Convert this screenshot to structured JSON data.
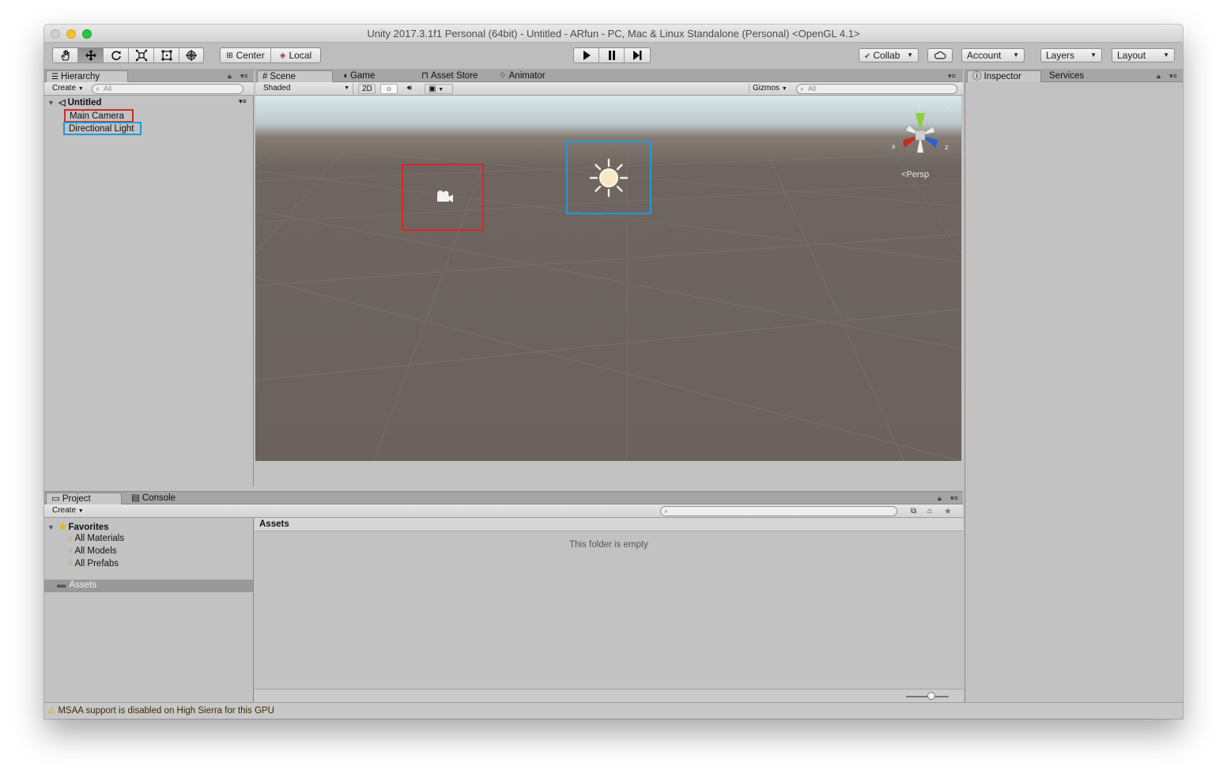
{
  "window": {
    "title": "Unity 2017.3.1f1 Personal (64bit) - Untitled - ARfun - PC, Mac & Linux Standalone (Personal) <OpenGL 4.1>"
  },
  "toolbar": {
    "transform_tools": [
      "hand-tool",
      "move-tool",
      "rotate-tool",
      "scale-tool",
      "rect-tool",
      "transform-tool"
    ],
    "pivot_label": "Center",
    "space_label": "Local",
    "collab_label": "Collab",
    "account_label": "Account",
    "layers_label": "Layers",
    "layout_label": "Layout"
  },
  "hierarchy": {
    "tab_label": "Hierarchy",
    "create_label": "Create",
    "search_placeholder": "All",
    "scene_name": "Untitled",
    "items": [
      {
        "label": "Main Camera",
        "highlight": "#d62728"
      },
      {
        "label": "Directional Light",
        "highlight": "#1f9ad6"
      }
    ]
  },
  "scene": {
    "tabs": [
      "Scene",
      "Game",
      "Asset Store",
      "Animator"
    ],
    "shading_mode": "Shaded",
    "mode_2d": "2D",
    "gizmos_label": "Gizmos",
    "search_placeholder": "All",
    "projection_label": "Persp",
    "axis_x": "x",
    "axis_y": "y",
    "axis_z": "z",
    "camera_highlight": "#d62728",
    "light_highlight": "#1f9ad6"
  },
  "inspector": {
    "tabs": [
      "Inspector",
      "Services"
    ]
  },
  "project": {
    "tabs": [
      "Project",
      "Console"
    ],
    "create_label": "Create",
    "favorites_label": "Favorites",
    "favorites": [
      "All Materials",
      "All Models",
      "All Prefabs"
    ],
    "assets_root": "Assets",
    "assets_header": "Assets",
    "empty_message": "This folder is empty"
  },
  "status": {
    "message": "MSAA support is disabled on High Sierra for this GPU"
  }
}
